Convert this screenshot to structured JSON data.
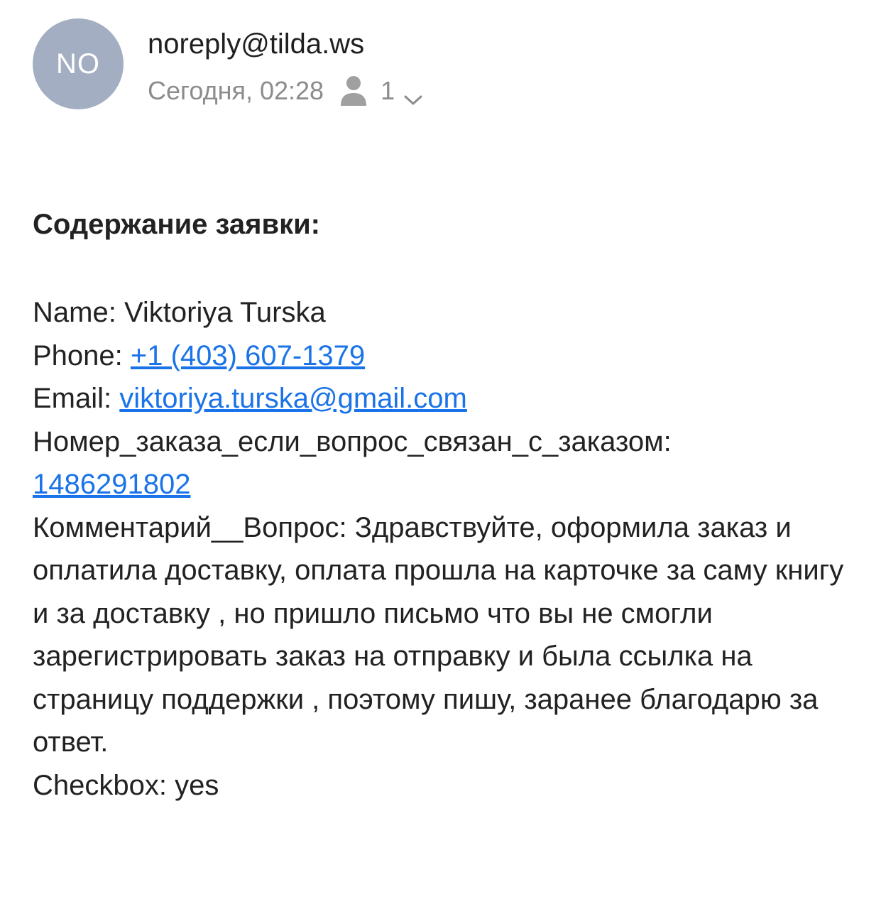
{
  "header": {
    "avatar_initials": "NO",
    "sender": "noreply@tilda.ws",
    "date": "Сегодня, 02:28",
    "recipients_count": "1",
    "icons": [
      "person-icon",
      "chevron-down-icon"
    ],
    "avatar_color": "#a3aec2"
  },
  "message": {
    "title": "Содержание заявки:",
    "name_label": "Name: ",
    "name_value": "Viktoriya Turska",
    "phone_label": "Phone: ",
    "phone_value": "+1 (403) 607-1379",
    "email_label": "Email: ",
    "email_value": "viktoriya.turska@gmail.com",
    "order_label": "Номер_заказа_если_вопрос_связан_с_заказом:",
    "order_value": "1486291802",
    "comment_label": "Комментарий__Вопрос: ",
    "comment_value": "Здравствуйте, оформила заказ и оплатила доставку, оплата прошла на карточке за саму книгу и за доставку , но пришло письмо что вы не смогли зарегистрировать заказ на отправку и была ссылка на страницу поддержки , поэтому пишу, заранее благодарю за ответ.",
    "checkbox_label": "Checkbox: ",
    "checkbox_value": "yes",
    "link_color": "#1a73e8"
  }
}
